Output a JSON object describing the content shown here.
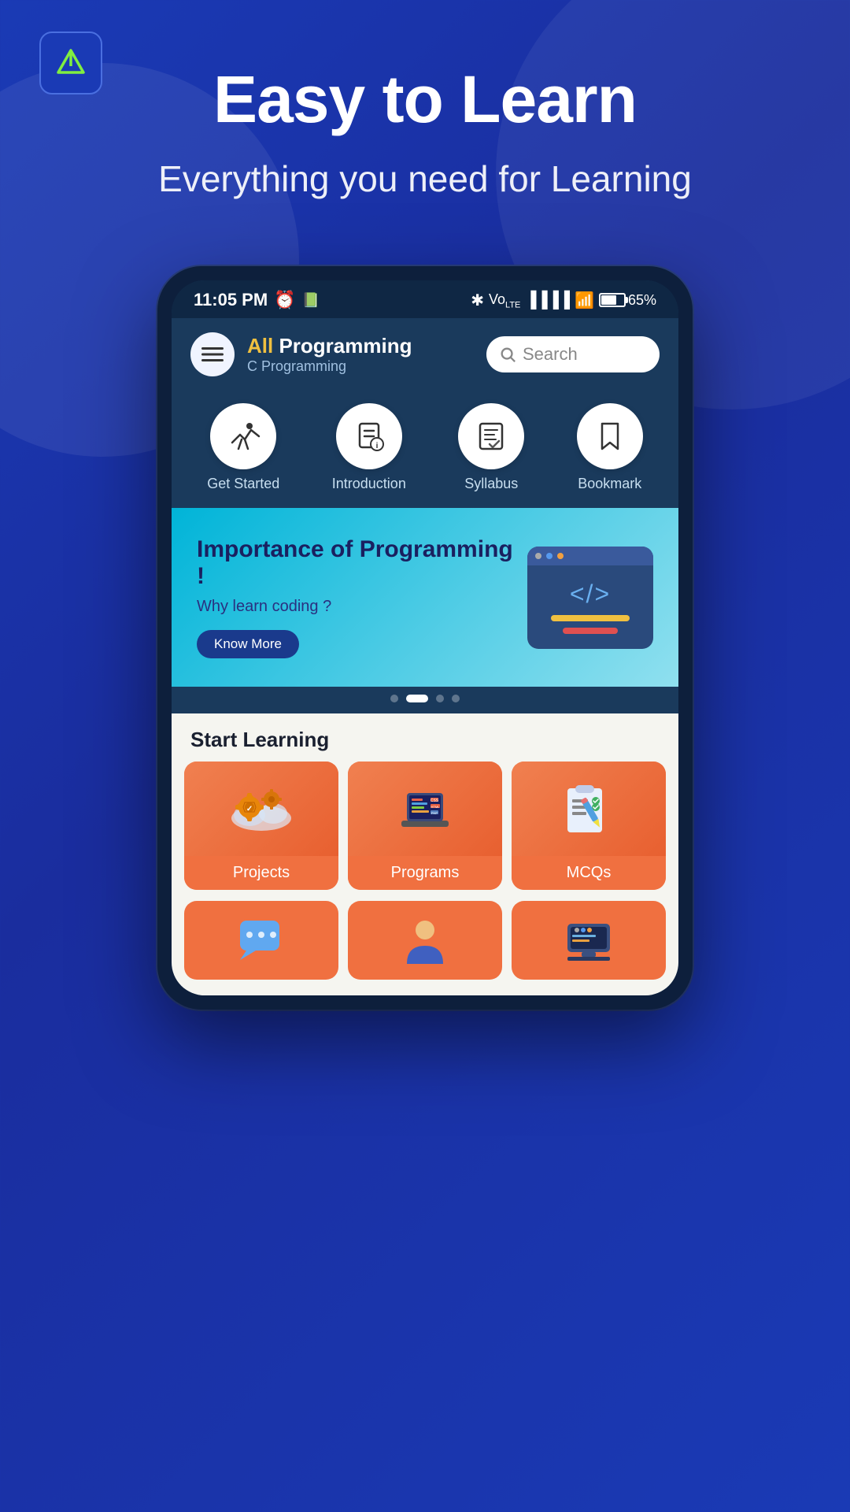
{
  "app": {
    "logo_letter": "Λ",
    "logo_bg": "#1a3ab5"
  },
  "hero": {
    "title": "Easy to Learn",
    "subtitle": "Everything you need for Learning"
  },
  "status_bar": {
    "time": "11:05 PM",
    "battery_pct": "65%"
  },
  "app_header": {
    "menu_label": "Menu",
    "title_all": "All",
    "title_rest": " Programming",
    "subtitle": "C Programming",
    "search_placeholder": "Search"
  },
  "nav": {
    "items": [
      {
        "id": "get-started",
        "label": "Get Started"
      },
      {
        "id": "introduction",
        "label": "Introduction"
      },
      {
        "id": "syllabus",
        "label": "Syllabus"
      },
      {
        "id": "bookmark",
        "label": "Bookmark"
      }
    ]
  },
  "banner": {
    "title": "Importance of  Programming !",
    "subtitle": "Why learn coding ?",
    "button_label": "Know More"
  },
  "dots": [
    {
      "active": false
    },
    {
      "active": true
    },
    {
      "active": false
    },
    {
      "active": false
    }
  ],
  "start_learning": {
    "section_title": "Start Learning",
    "cards": [
      {
        "id": "projects",
        "label": "Projects"
      },
      {
        "id": "programs",
        "label": "Programs"
      },
      {
        "id": "mcqs",
        "label": "MCQs"
      }
    ],
    "bottom_cards": [
      {
        "id": "card4",
        "label": ""
      },
      {
        "id": "card5",
        "label": ""
      },
      {
        "id": "card6",
        "label": ""
      }
    ]
  }
}
